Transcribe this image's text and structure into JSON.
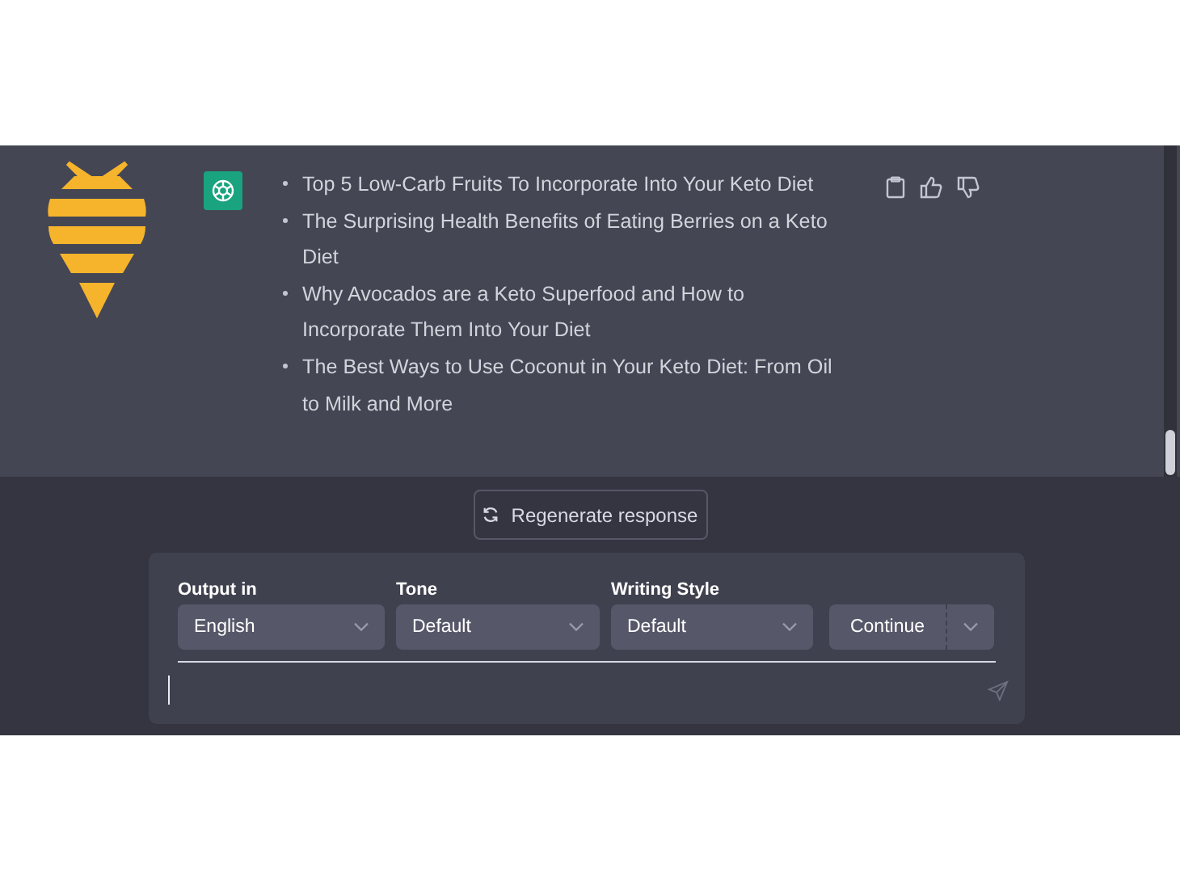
{
  "message": {
    "items": [
      "Top 5 Low-Carb Fruits To Incorporate Into Your Keto Diet",
      "The Surprising Health Benefits of Eating Berries on a Keto Diet",
      "Why Avocados are a Keto Superfood and How to Incorporate Them Into Your Diet",
      "The Best Ways to Use Coconut in Your Keto Diet: From Oil to Milk and More"
    ]
  },
  "regenerate_button": "Regenerate response",
  "options": [
    {
      "label": "Output in",
      "value": "English"
    },
    {
      "label": "Tone",
      "value": "Default"
    },
    {
      "label": "Writing Style",
      "value": "Default"
    }
  ],
  "continue_button": "Continue"
}
